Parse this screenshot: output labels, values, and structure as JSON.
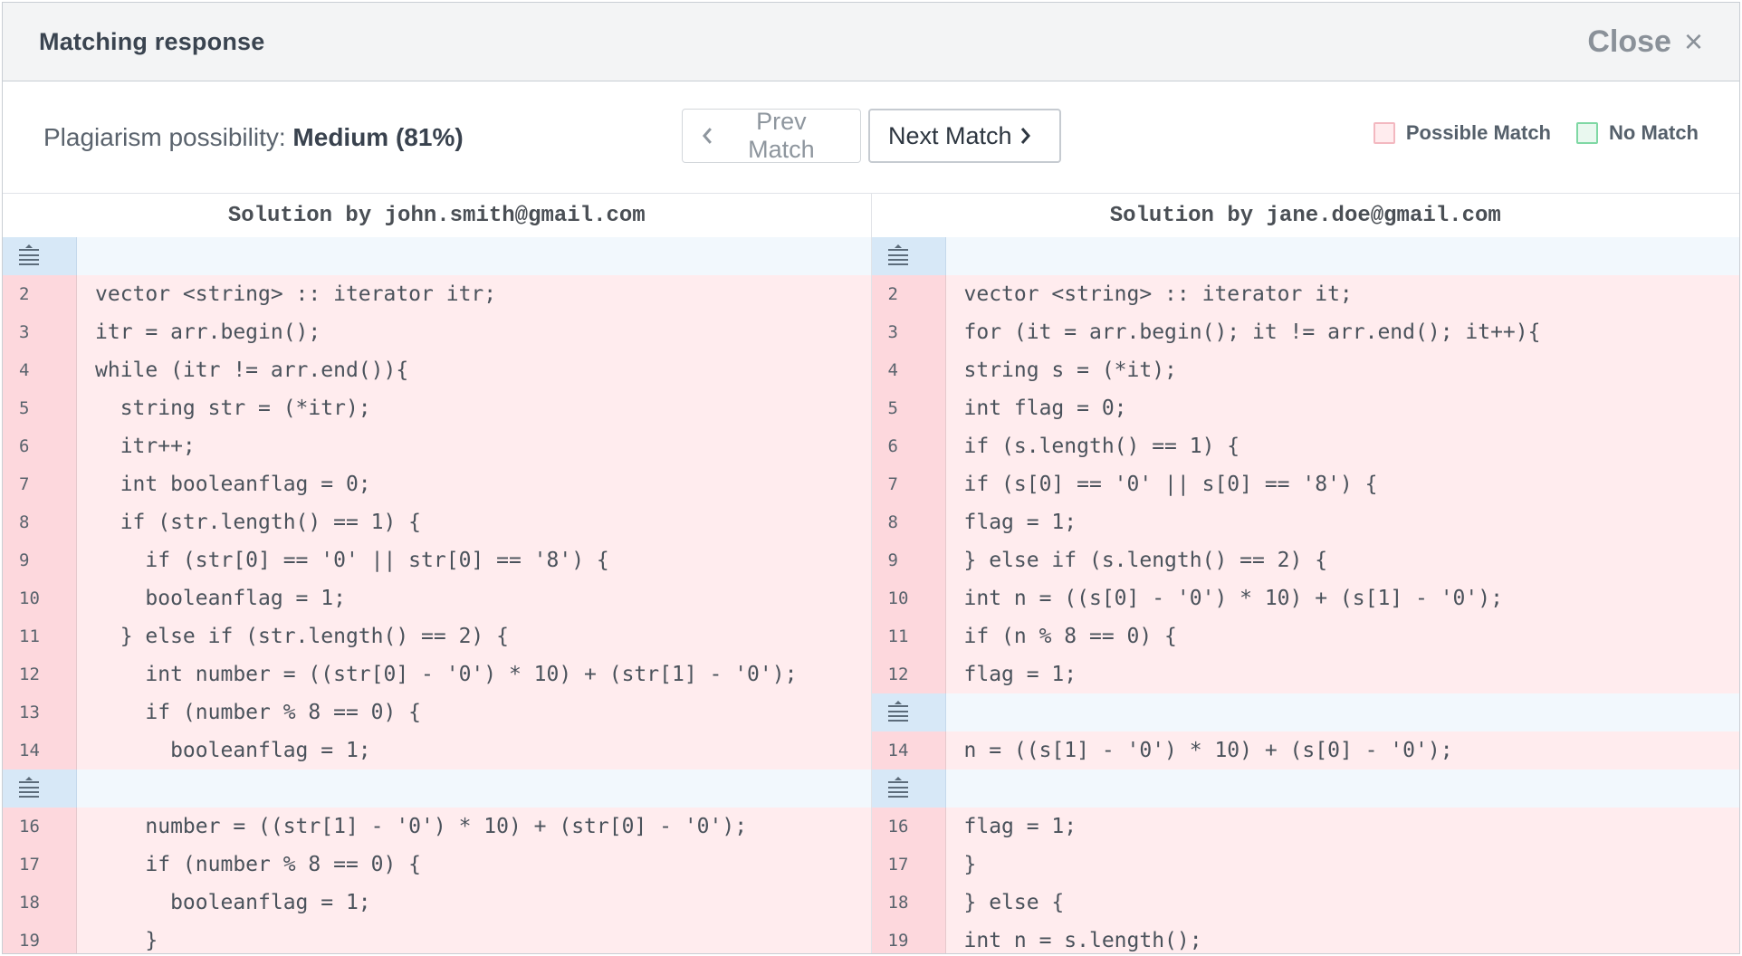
{
  "header": {
    "title": "Matching response",
    "close_label": "Close",
    "close_icon": "×"
  },
  "toolbar": {
    "plag_label": "Plagiarism possibility:",
    "plag_value": "Medium (81%)",
    "prev_label": "Prev Match",
    "next_label": "Next Match",
    "legend": [
      {
        "label": "Possible Match",
        "color": "#f3b8c0",
        "fill": "#ffecee"
      },
      {
        "label": "No Match",
        "color": "#7fd8a4",
        "fill": "#e9f8ef"
      }
    ]
  },
  "colors": {
    "match_bg": "#ffecee",
    "match_gutter": "#fdd8dd",
    "fold_bg": "#f2f8fd",
    "fold_gutter": "#d7e8f7"
  },
  "left": {
    "title": "Solution by john.smith@gmail.com",
    "rows": [
      {
        "type": "fold"
      },
      {
        "type": "match",
        "num": "2",
        "code": "vector <string> :: iterator itr;"
      },
      {
        "type": "match",
        "num": "3",
        "code": "itr = arr.begin();"
      },
      {
        "type": "match",
        "num": "4",
        "code": "while (itr != arr.end()){"
      },
      {
        "type": "match",
        "num": "5",
        "code": "  string str = (*itr);"
      },
      {
        "type": "match",
        "num": "6",
        "code": "  itr++;"
      },
      {
        "type": "match",
        "num": "7",
        "code": "  int booleanflag = 0;"
      },
      {
        "type": "match",
        "num": "8",
        "code": "  if (str.length() == 1) {"
      },
      {
        "type": "match",
        "num": "9",
        "code": "    if (str[0] == '0' || str[0] == '8') {"
      },
      {
        "type": "match",
        "num": "10",
        "code": "    booleanflag = 1;"
      },
      {
        "type": "match",
        "num": "11",
        "code": "  } else if (str.length() == 2) {"
      },
      {
        "type": "match",
        "num": "12",
        "code": "    int number = ((str[0] - '0') * 10) + (str[1] - '0');"
      },
      {
        "type": "match",
        "num": "13",
        "code": "    if (number % 8 == 0) {"
      },
      {
        "type": "match",
        "num": "14",
        "code": "      booleanflag = 1;"
      },
      {
        "type": "fold"
      },
      {
        "type": "match",
        "num": "16",
        "code": "    number = ((str[1] - '0') * 10) + (str[0] - '0');"
      },
      {
        "type": "match",
        "num": "17",
        "code": "    if (number % 8 == 0) {"
      },
      {
        "type": "match",
        "num": "18",
        "code": "      booleanflag = 1;"
      },
      {
        "type": "match",
        "num": "19",
        "code": "    }"
      }
    ]
  },
  "right": {
    "title": "Solution by jane.doe@gmail.com",
    "rows": [
      {
        "type": "fold"
      },
      {
        "type": "match",
        "num": "2",
        "code": "vector <string> :: iterator it;"
      },
      {
        "type": "match",
        "num": "3",
        "code": "for (it = arr.begin(); it != arr.end(); it++){"
      },
      {
        "type": "match",
        "num": "4",
        "code": "string s = (*it);"
      },
      {
        "type": "match",
        "num": "5",
        "code": "int flag = 0;"
      },
      {
        "type": "match",
        "num": "6",
        "code": "if (s.length() == 1) {"
      },
      {
        "type": "match",
        "num": "7",
        "code": "if (s[0] == '0' || s[0] == '8') {"
      },
      {
        "type": "match",
        "num": "8",
        "code": "flag = 1;"
      },
      {
        "type": "match",
        "num": "9",
        "code": "} else if (s.length() == 2) {"
      },
      {
        "type": "match",
        "num": "10",
        "code": "int n = ((s[0] - '0') * 10) + (s[1] - '0');"
      },
      {
        "type": "match",
        "num": "11",
        "code": "if (n % 8 == 0) {"
      },
      {
        "type": "match",
        "num": "12",
        "code": "flag = 1;"
      },
      {
        "type": "fold"
      },
      {
        "type": "match",
        "num": "14",
        "code": "n = ((s[1] - '0') * 10) + (s[0] - '0');"
      },
      {
        "type": "fold"
      },
      {
        "type": "match",
        "num": "16",
        "code": "flag = 1;"
      },
      {
        "type": "match",
        "num": "17",
        "code": "}"
      },
      {
        "type": "match",
        "num": "18",
        "code": "} else {"
      },
      {
        "type": "match",
        "num": "19",
        "code": "int n = s.length();"
      }
    ]
  }
}
